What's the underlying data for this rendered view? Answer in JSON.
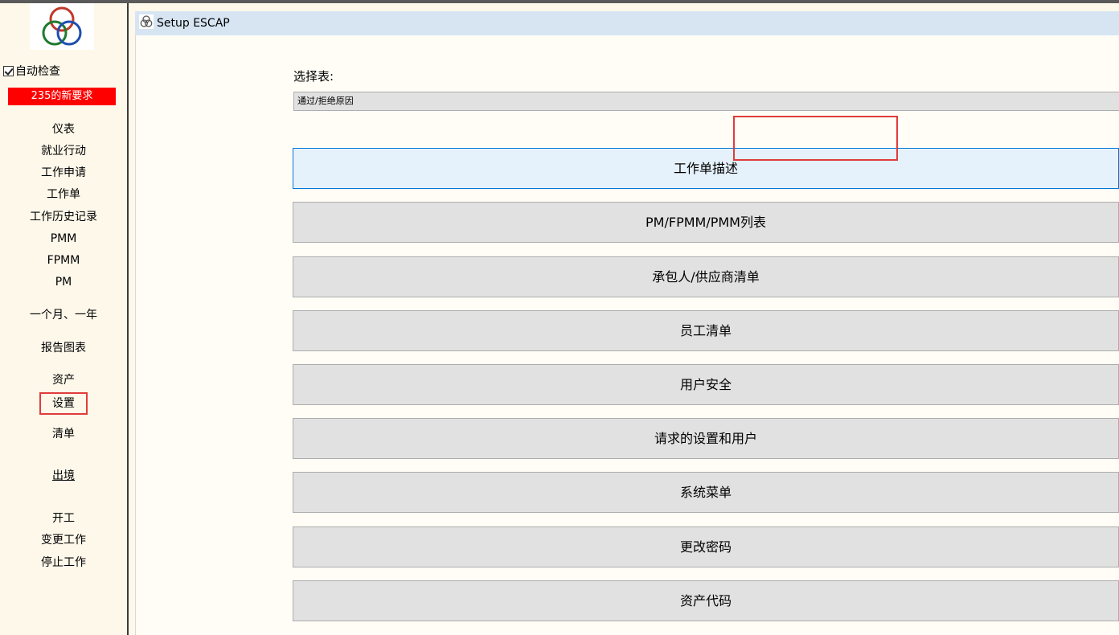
{
  "sidebar": {
    "auto_check_label": "自动检查",
    "auto_check_checked": true,
    "new_requests_badge": "235的新要求",
    "items": [
      {
        "label": "仪表"
      },
      {
        "label": "就业行动"
      },
      {
        "label": "工作申请"
      },
      {
        "label": "工作单"
      },
      {
        "label": "工作历史记录"
      },
      {
        "label": "PMM"
      },
      {
        "label": "FPMM"
      },
      {
        "label": "PM"
      },
      {
        "label": "一个月、一年"
      },
      {
        "label": "报告图表"
      },
      {
        "label": "资产"
      },
      {
        "label": "设置"
      },
      {
        "label": "清单"
      },
      {
        "label": "出境"
      },
      {
        "label": "开工"
      },
      {
        "label": "变更工作"
      },
      {
        "label": "停止工作"
      }
    ]
  },
  "window": {
    "title": "Setup ESCAP"
  },
  "main": {
    "select_label": "选择表:",
    "select_value": "通过/拒绝原因",
    "buttons": [
      {
        "label": "工作单描述"
      },
      {
        "label": "PM/FPMM/PMM列表"
      },
      {
        "label": "承包人/供应商清单"
      },
      {
        "label": "员工清单"
      },
      {
        "label": "用户安全"
      },
      {
        "label": "请求的设置和用户"
      },
      {
        "label": "系统菜单"
      },
      {
        "label": "更改密码"
      },
      {
        "label": "资产代码"
      }
    ]
  },
  "colors": {
    "badge_bg": "#ff0000",
    "highlight": "#e03c3c",
    "titlebar_bg": "#d7e5f3",
    "button_bg": "#e1e1e1",
    "button_active_bg": "#e5f1fb",
    "button_active_border": "#0078d7",
    "sidebar_bg": "#fdf8ea"
  },
  "icons": {
    "app_logo": "three-rings-logo-icon",
    "window_icon": "three-rings-window-icon"
  }
}
